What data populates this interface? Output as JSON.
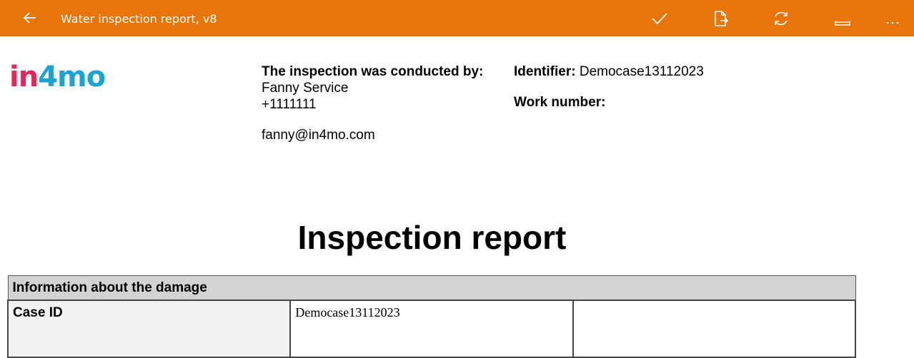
{
  "app": {
    "title": "Water inspection report, v8",
    "accent_color": "#e8750a",
    "toolbar_icons": [
      "back-arrow-icon",
      "checkmark-icon",
      "document-export-icon",
      "refresh-icon",
      "ruler-icon",
      "more-icon"
    ]
  },
  "logo": {
    "text": "in4mo",
    "colors": [
      "#e8245a",
      "#1aa3d6"
    ]
  },
  "contact": {
    "conducted_by_label": "The inspection was conducted by:",
    "name": "Fanny Service",
    "phone": "+1111111",
    "email": "fanny@in4mo.com"
  },
  "identifiers": {
    "identifier_label": "Identifier:",
    "identifier_value": "Democase13112023",
    "work_number_label": "Work number:"
  },
  "report": {
    "title": "Inspection report"
  },
  "damage_table": {
    "header": "Information about the damage",
    "rows": [
      {
        "label": "Case ID",
        "value": "Democase13112023",
        "extra": ""
      }
    ]
  }
}
